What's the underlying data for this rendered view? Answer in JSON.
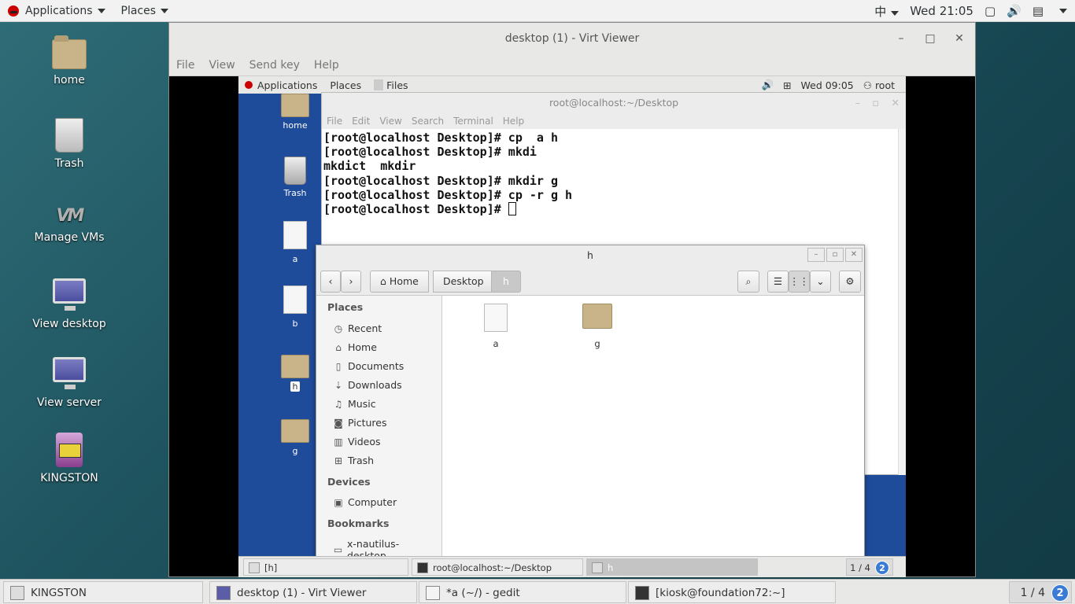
{
  "host_topbar": {
    "applications": "Applications",
    "places": "Places",
    "input_method": "中",
    "clock": "Wed 21:05"
  },
  "host_desktop_icons": [
    {
      "label": "home",
      "icon": "home-folder-icon"
    },
    {
      "label": "Trash",
      "icon": "trash-icon"
    },
    {
      "label": "Manage VMs",
      "icon": "vmm-icon"
    },
    {
      "label": "View desktop",
      "icon": "monitor-icon"
    },
    {
      "label": "View server",
      "icon": "monitor-icon"
    },
    {
      "label": "KINGSTON",
      "icon": "usb-drive-icon"
    }
  ],
  "virt_viewer": {
    "title": "desktop (1) - Virt Viewer",
    "menu": [
      "File",
      "View",
      "Send key",
      "Help"
    ]
  },
  "guest_topbar": {
    "applications": "Applications",
    "places": "Places",
    "files": "Files",
    "clock": "Wed 09:05",
    "user": "root"
  },
  "guest_desktop_icons": [
    {
      "label": "home"
    },
    {
      "label": "Trash"
    },
    {
      "label": "a"
    },
    {
      "label": "b"
    },
    {
      "label": "h"
    },
    {
      "label": "g"
    }
  ],
  "terminal": {
    "title": "root@localhost:~/Desktop",
    "menu": [
      "File",
      "Edit",
      "View",
      "Search",
      "Terminal",
      "Help"
    ],
    "lines": [
      "[root@localhost Desktop]# cp  a h",
      "[root@localhost Desktop]# mkdi",
      "mkdict  mkdir",
      "[root@localhost Desktop]# mkdir g",
      "[root@localhost Desktop]# cp -r g h",
      "[root@localhost Desktop]# "
    ]
  },
  "file_manager": {
    "title": "h",
    "breadcrumbs": [
      "Home",
      "Desktop",
      "h"
    ],
    "sidebar": {
      "places_header": "Places",
      "places": [
        {
          "label": "Recent",
          "icon": "clock-icon"
        },
        {
          "label": "Home",
          "icon": "home-icon"
        },
        {
          "label": "Documents",
          "icon": "document-icon"
        },
        {
          "label": "Downloads",
          "icon": "download-icon"
        },
        {
          "label": "Music",
          "icon": "music-icon"
        },
        {
          "label": "Pictures",
          "icon": "camera-icon"
        },
        {
          "label": "Videos",
          "icon": "film-icon"
        },
        {
          "label": "Trash",
          "icon": "trash-icon"
        }
      ],
      "devices_header": "Devices",
      "devices": [
        {
          "label": "Computer",
          "icon": "drive-icon"
        }
      ],
      "bookmarks_header": "Bookmarks",
      "bookmarks": [
        {
          "label": "x-nautilus-desktop...",
          "icon": "folder-icon"
        }
      ]
    },
    "items": [
      {
        "label": "a",
        "type": "file"
      },
      {
        "label": "g",
        "type": "folder"
      }
    ]
  },
  "guest_taskbar": {
    "items": [
      "[h]",
      "root@localhost:~/Desktop",
      "h"
    ],
    "workspace": "1 / 4",
    "badge": "2"
  },
  "host_taskbar": {
    "items": [
      "KINGSTON",
      "desktop (1) - Virt Viewer",
      "*a (~/) - gedit",
      "[kiosk@foundation72:~]"
    ],
    "workspace": "1 / 4",
    "badge": "2"
  }
}
